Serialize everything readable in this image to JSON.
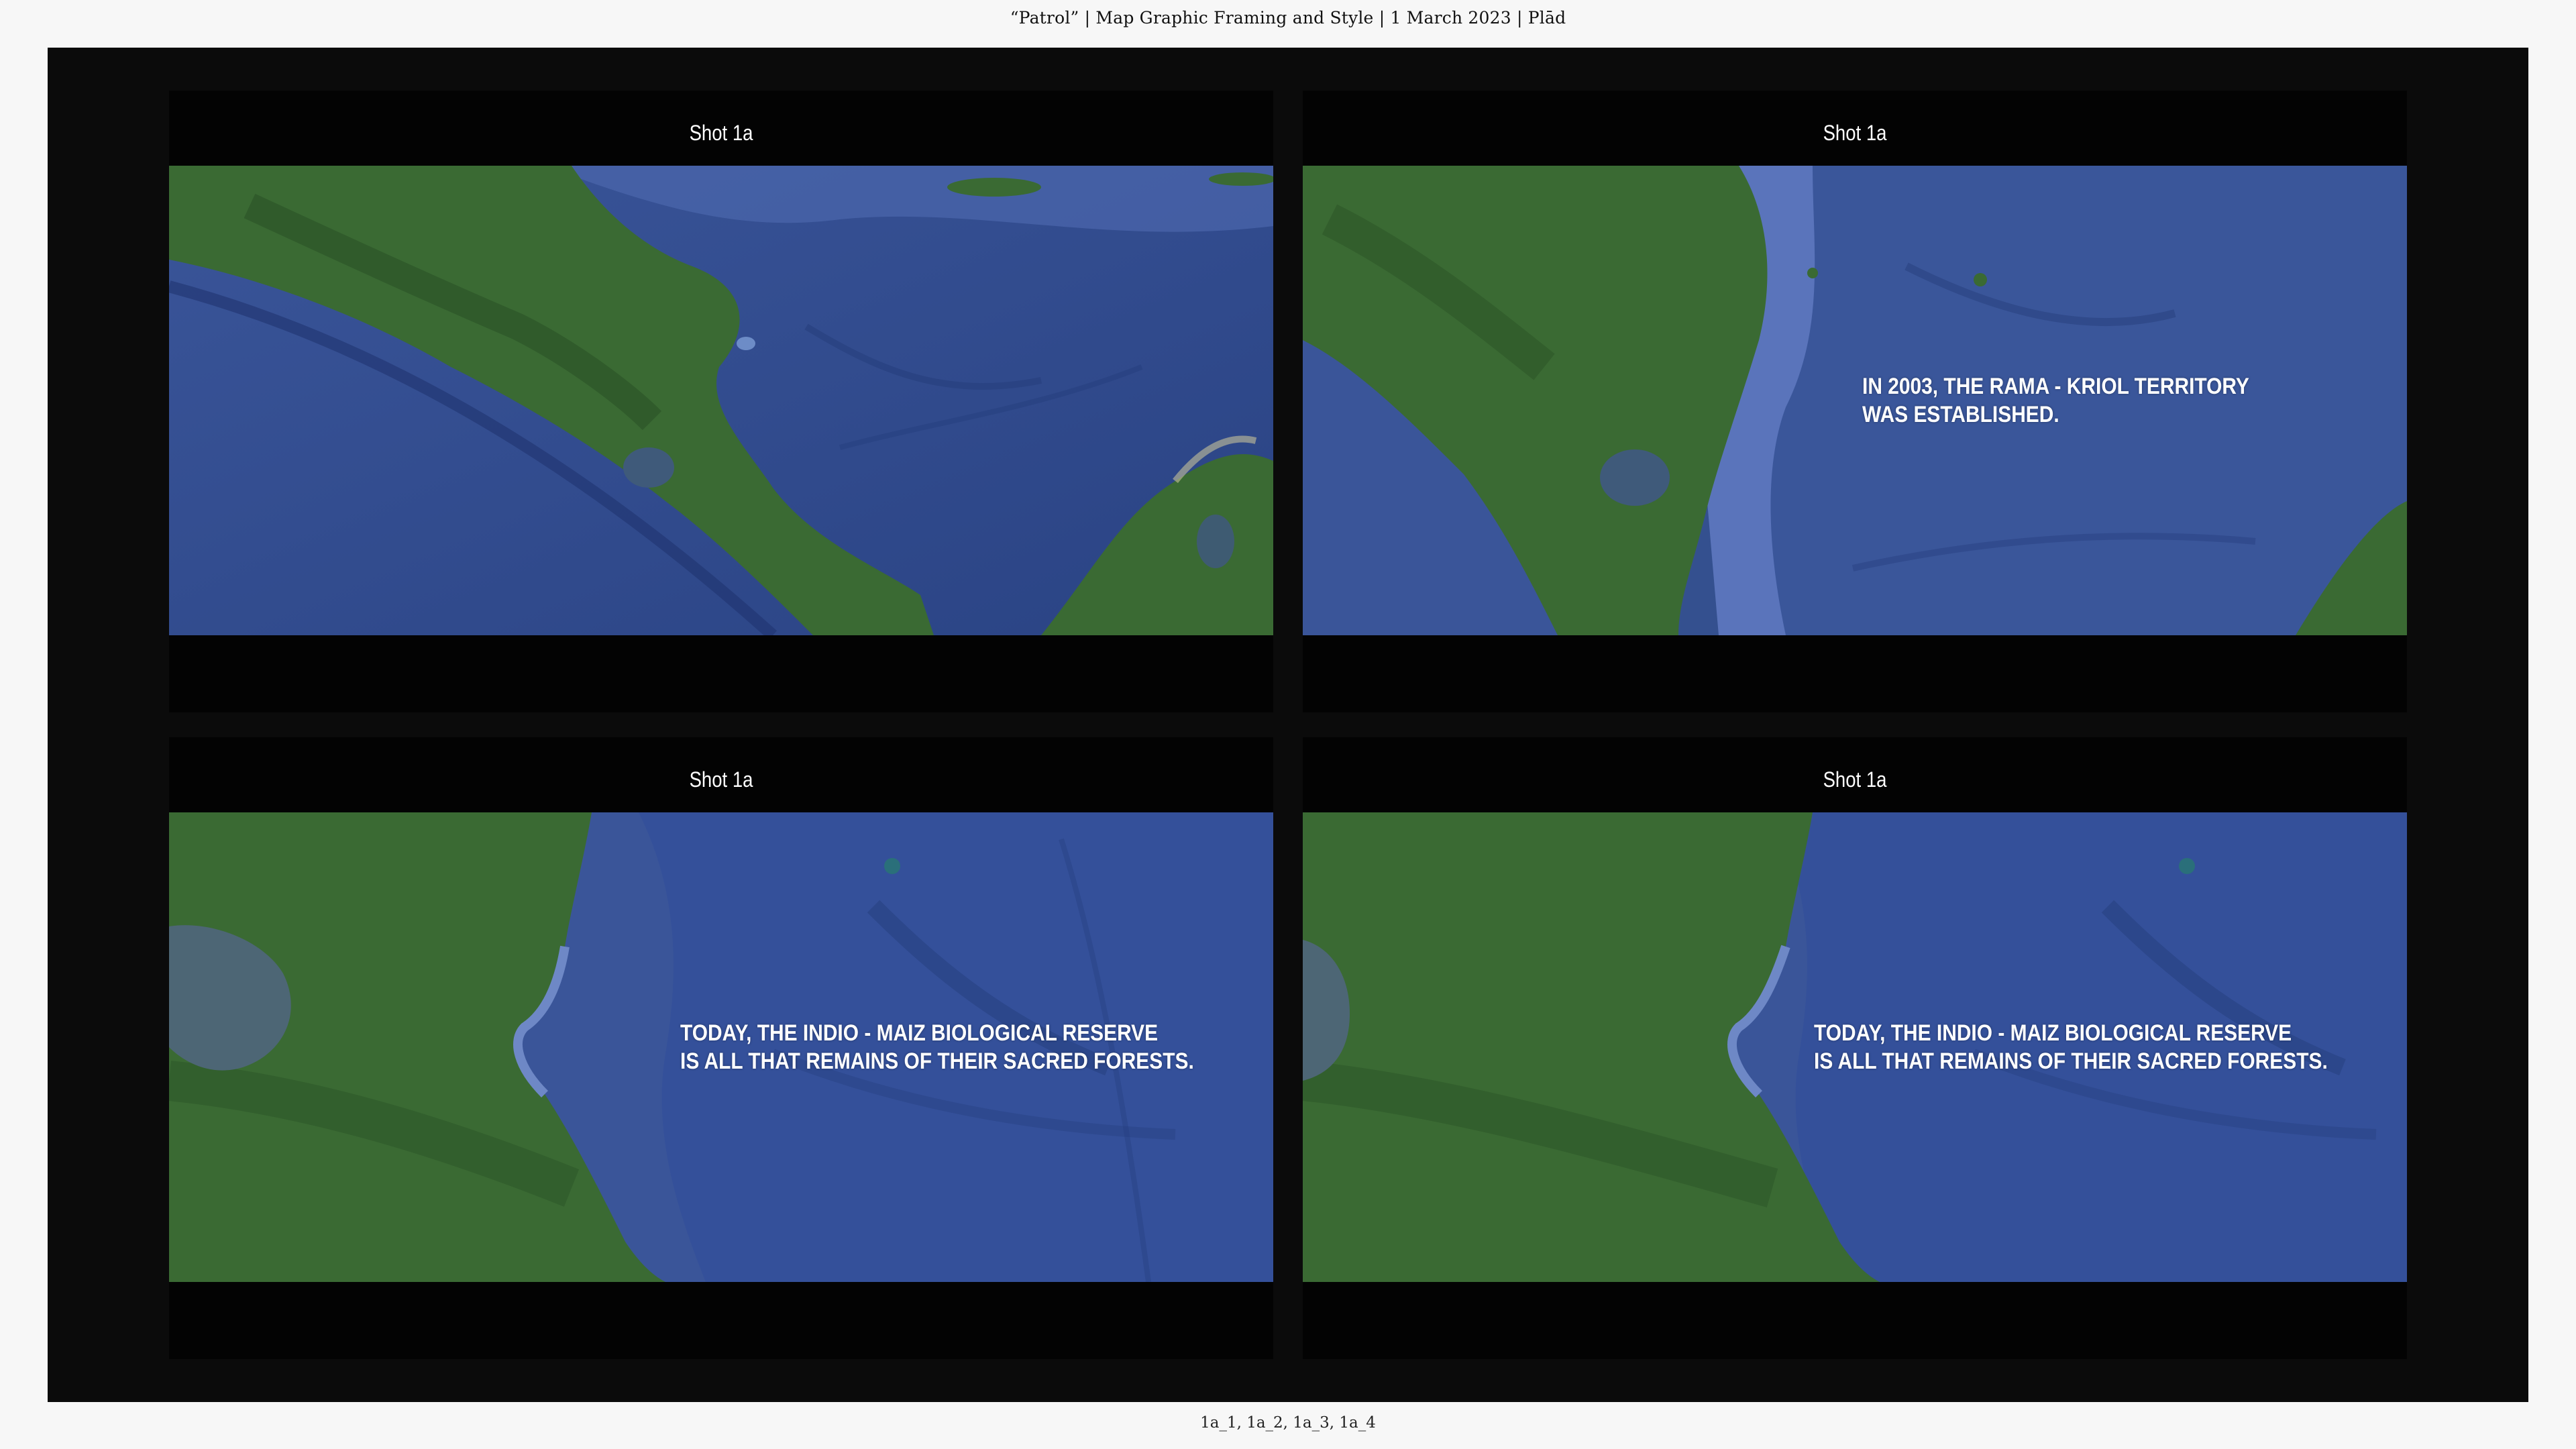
{
  "header": {
    "title": "“Patrol” | Map Graphic Framing and Style | 1 March 2023 | Plād"
  },
  "footer": {
    "frames_label": "1a_1, 1a_2, 1a_3, 1a_4"
  },
  "frames": [
    {
      "title": "Shot 1a",
      "caption_line1": "",
      "caption_line2": ""
    },
    {
      "title": "Shot 1a",
      "caption_line1": "IN 2003, THE RAMA - KRIOL TERRITORY",
      "caption_line2": "WAS ESTABLISHED."
    },
    {
      "title": "Shot 1a",
      "caption_line1": "TODAY, THE INDIO - MAIZ BIOLOGICAL RESERVE",
      "caption_line2": "IS ALL THAT REMAINS OF THEIR SACRED FORESTS."
    },
    {
      "title": "Shot 1a",
      "caption_line1": "TODAY, THE INDIO - MAIZ BIOLOGICAL RESERVE",
      "caption_line2": "IS ALL THAT REMAINS OF THEIR SACRED FORESTS."
    }
  ],
  "colors": {
    "ocean_deep": "#2f4a8c",
    "ocean_shallow": "#5a72b8",
    "land": "#3c6a35",
    "land_dark": "#28502a",
    "frame_bg": "#030303",
    "board_bg": "#0b0b0b"
  }
}
